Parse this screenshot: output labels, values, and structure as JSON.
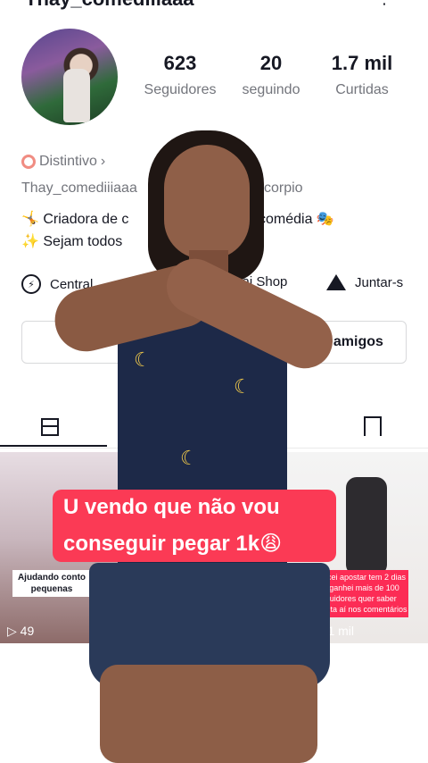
{
  "profile": {
    "username": "Thay_comediiiaaa",
    "stats": [
      {
        "value": "623",
        "label": "Seguidores"
      },
      {
        "value": "20",
        "label": "seguindo"
      },
      {
        "value": "1.7 mil",
        "label": "Curtidas"
      }
    ],
    "badge_label": "Distintivo",
    "handle": "Thay_comediiiaaa",
    "handle_tail": "scorpio",
    "bio_line1": "🤸 Criadora de c",
    "bio_line1_tail": "comédia 🎭",
    "bio_line2": "✨ Sejam todos"
  },
  "links": {
    "central": "Central",
    "shop": "vai Shop",
    "join": "Juntar-s"
  },
  "buttons": {
    "add_friends": "icionar amigos"
  },
  "videos": [
    {
      "caption": "Ajudando conto pequenas",
      "views": "49"
    },
    {
      "caption": "comecei apostar tem 2 dias e já ganhei mais de 100 seguidores quer saber comenta aí nos comentários",
      "views": "21.1 mil"
    }
  ],
  "overlay": {
    "line1": "U vendo que não vou",
    "line2": "conseguir pegar 1k😩"
  }
}
